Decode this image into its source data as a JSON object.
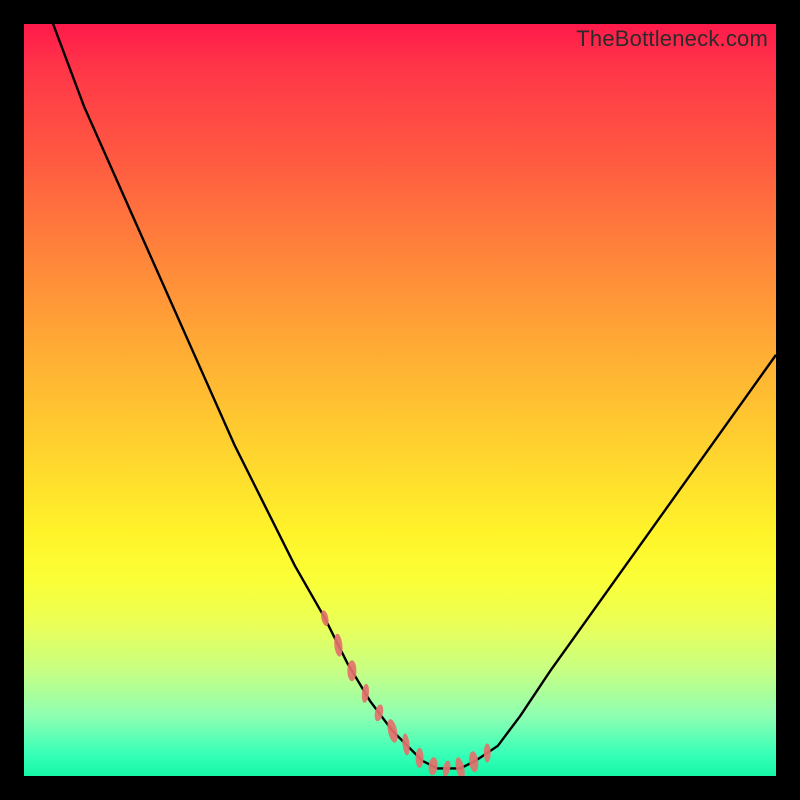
{
  "watermark": "TheBottleneck.com",
  "colors": {
    "frame": "#000000",
    "curve": "#000000",
    "marker": "#e4716b",
    "gradient_top": "#ff1a4b",
    "gradient_bottom": "#15f7a8"
  },
  "chart_data": {
    "type": "line",
    "title": "",
    "xlabel": "",
    "ylabel": "",
    "xlim": [
      0,
      100
    ],
    "ylim": [
      0,
      100
    ],
    "x": [
      0,
      2,
      5,
      8,
      12,
      16,
      20,
      24,
      28,
      32,
      36,
      40,
      43,
      46,
      49,
      51,
      53,
      55,
      57,
      58,
      60,
      63,
      66,
      70,
      75,
      80,
      85,
      90,
      95,
      100
    ],
    "values": [
      115,
      105,
      97,
      89,
      80,
      71,
      62,
      53,
      44,
      36,
      28,
      21,
      15,
      10,
      6,
      4,
      2,
      1,
      1,
      1,
      2,
      4,
      8,
      14,
      21,
      28,
      35,
      42,
      49,
      56
    ],
    "highlight_band": {
      "x_start": 40,
      "x_end": 63,
      "description": "dense red marker region near curve minimum"
    }
  }
}
